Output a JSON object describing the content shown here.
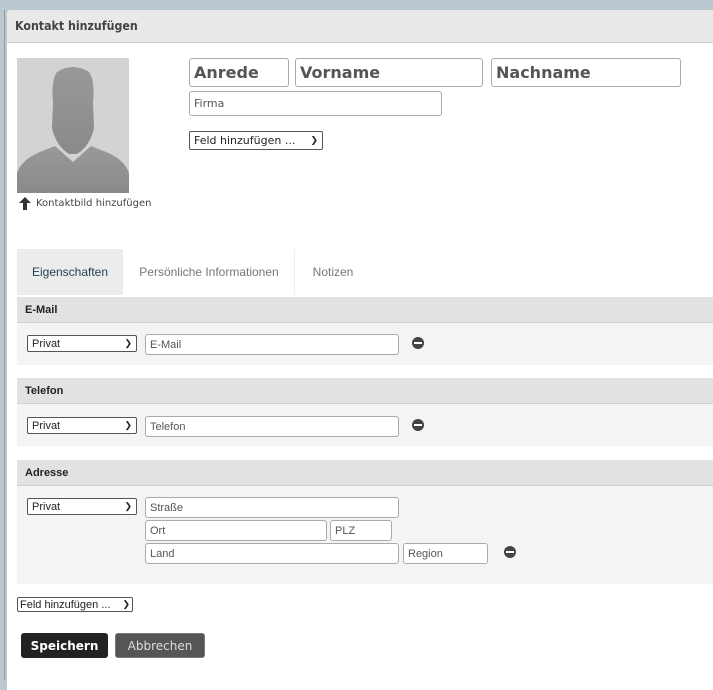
{
  "dialog": {
    "title": "Kontakt hinzufügen"
  },
  "photo": {
    "upload_label": "Kontaktbild hinzufügen",
    "icon": "arrow-up-icon"
  },
  "name": {
    "salutation_placeholder": "Anrede",
    "first_placeholder": "Vorname",
    "last_placeholder": "Nachname",
    "company_placeholder": "Firma"
  },
  "add_field_top": "Feld hinzufügen ...",
  "tabs": [
    {
      "label": "Eigenschaften",
      "active": true
    },
    {
      "label": "Persönliche Informationen"
    },
    {
      "label": "Notizen"
    }
  ],
  "email": {
    "title": "E-Mail",
    "type": "Privat",
    "placeholder": "E-Mail"
  },
  "phone": {
    "title": "Telefon",
    "type": "Privat",
    "placeholder": "Telefon"
  },
  "address": {
    "title": "Adresse",
    "type": "Privat",
    "street": "Straße",
    "city": "Ort",
    "zip": "PLZ",
    "country": "Land",
    "region": "Region"
  },
  "add_field_bottom": "Feld hinzufügen ...",
  "buttons": {
    "save": "Speichern",
    "cancel": "Abbrechen"
  },
  "colors": {
    "save_bg": "#222222",
    "cancel_bg": "#555555",
    "active_tab_bg": "#ececec"
  }
}
